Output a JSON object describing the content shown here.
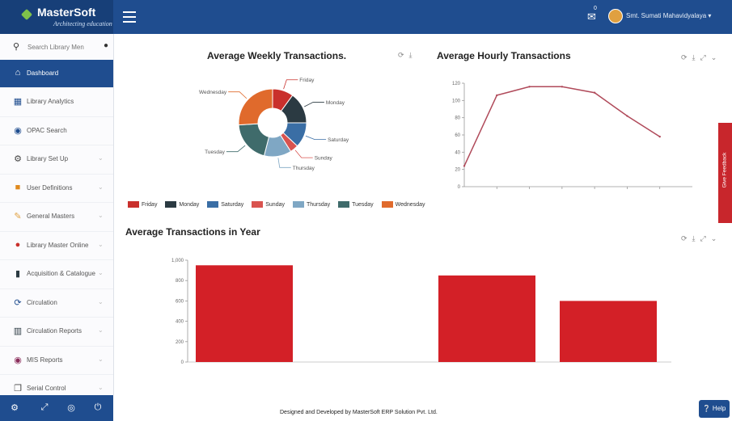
{
  "app": {
    "logo_title": "MasterSoft",
    "logo_tagline": "Architecting education",
    "notification_count": "0",
    "user_name": "Smt. Sumati Mahavidyalaya"
  },
  "sidebar": {
    "search_placeholder": "Search Library Men",
    "items": [
      {
        "label": "Dashboard",
        "icon": "home-icon",
        "active": true
      },
      {
        "label": "Library Analytics",
        "icon": "bar-chart-icon"
      },
      {
        "label": "OPAC Search",
        "icon": "globe-icon"
      },
      {
        "label": "Library Set Up",
        "icon": "cogs-icon"
      },
      {
        "label": "User Definitions",
        "icon": "users-icon"
      },
      {
        "label": "General Masters",
        "icon": "edit-icon"
      },
      {
        "label": "Library Master Online",
        "icon": "user-group-icon"
      },
      {
        "label": "Acquisition & Catalogue",
        "icon": "book-icon"
      },
      {
        "label": "Circulation",
        "icon": "refresh-icon"
      },
      {
        "label": "Circulation Reports",
        "icon": "chart-report-icon"
      },
      {
        "label": "MIS Reports",
        "icon": "database-icon"
      },
      {
        "label": "Serial Control",
        "icon": "copy-icon"
      }
    ]
  },
  "weekly": {
    "title": "Average Weekly Transactions."
  },
  "hourly": {
    "title": "Average Hourly Transactions"
  },
  "yearly": {
    "title": "Average Transactions in Year"
  },
  "colors": {
    "brand": "#1f4d8f",
    "friday": "#c9302c",
    "monday": "#2b3a42",
    "saturday": "#3a6ea5",
    "sunday": "#d9534f",
    "thursday": "#7fa7c4",
    "tuesday": "#3f6b6b",
    "wednesday": "#e06a2c",
    "line": "#b04a5a",
    "bar": "#d32027"
  },
  "chart_data": [
    {
      "type": "pie",
      "title": "Average Weekly Transactions.",
      "labels": [
        "Friday",
        "Monday",
        "Saturday",
        "Sunday",
        "Thursday",
        "Tuesday",
        "Wednesday"
      ],
      "values": [
        10,
        15,
        12,
        4,
        13,
        20,
        26
      ],
      "legend": "bottom"
    },
    {
      "type": "line",
      "title": "Average Hourly Transactions",
      "x": [
        0,
        1,
        2,
        3,
        4,
        5,
        6
      ],
      "values": [
        24,
        106,
        116,
        116,
        109,
        82,
        58
      ],
      "ylim": [
        0,
        120
      ],
      "yticks": [
        0,
        20,
        40,
        60,
        80,
        100,
        120
      ]
    },
    {
      "type": "bar",
      "title": "Average Transactions in Year",
      "values": [
        950,
        null,
        850,
        600
      ],
      "ylim": [
        0,
        1000
      ],
      "yticks": [
        "0",
        "200",
        "400",
        "600",
        "800",
        "1,000"
      ]
    }
  ],
  "footer": {
    "text": "Designed and Developed by MasterSoft ERP Solution Pvt. Ltd.",
    "help_label": "Help",
    "feedback_label": "Give Feedback"
  }
}
